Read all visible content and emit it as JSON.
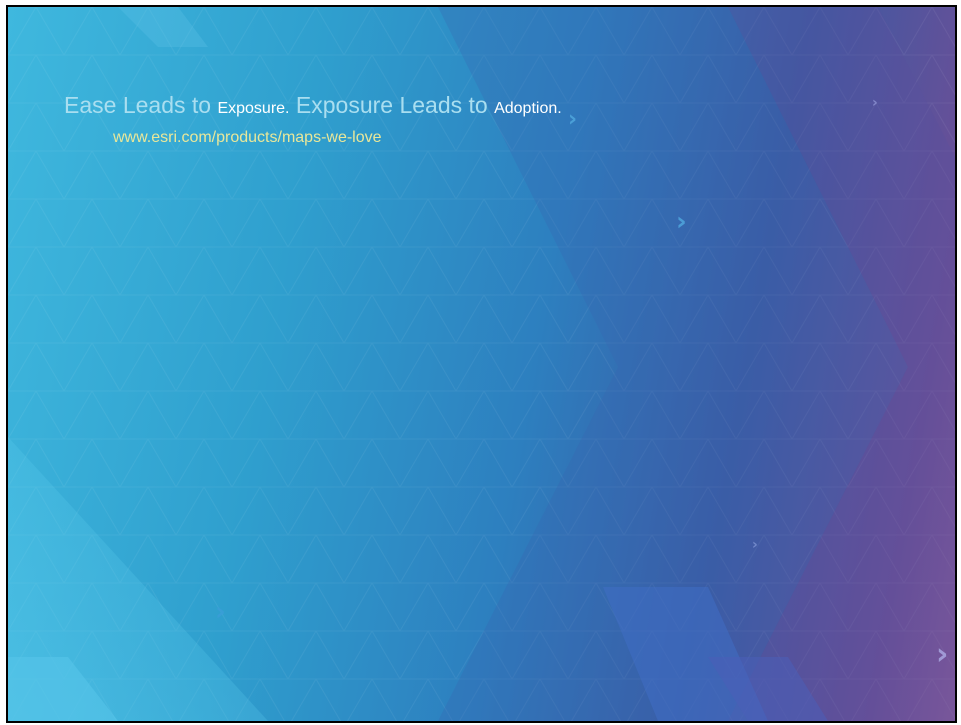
{
  "slide": {
    "title_parts": [
      {
        "text": "Ease Leads to ",
        "style": "big"
      },
      {
        "text": "Exposure.",
        "style": "small"
      },
      {
        "text": " Exposure Leads to ",
        "style": "big"
      },
      {
        "text": "Adoption.",
        "style": "small"
      }
    ],
    "url": "www.esri.com/products/maps-we-love"
  },
  "colors": {
    "title_text": "#a9def0",
    "emphasis_text": "#ffffff",
    "url_text": "#e8e79a",
    "background_left": "#3fb8de",
    "background_right": "#8a5a98"
  },
  "decorations": {
    "chevron_icon": "chevron-right-icon"
  }
}
